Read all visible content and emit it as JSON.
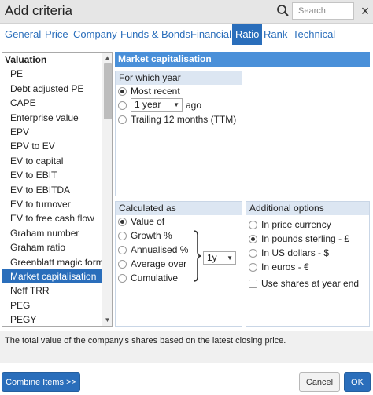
{
  "window": {
    "title": "Add criteria"
  },
  "search": {
    "placeholder": "Search",
    "icon": "search-icon"
  },
  "close": {
    "symbol": "×"
  },
  "tabs": [
    {
      "label": "General"
    },
    {
      "label": "Price"
    },
    {
      "label": "Company"
    },
    {
      "label": "Funds & Bonds"
    },
    {
      "label": "Financial"
    },
    {
      "label": "Ratio",
      "active": true
    },
    {
      "label": "Rank"
    },
    {
      "label": "Technical"
    }
  ],
  "criteria_list": {
    "items": [
      {
        "label": "Valuation",
        "header": true
      },
      {
        "label": "PE"
      },
      {
        "label": "Debt adjusted PE"
      },
      {
        "label": "CAPE"
      },
      {
        "label": "Enterprise value"
      },
      {
        "label": "EPV"
      },
      {
        "label": "EPV to EV"
      },
      {
        "label": "EV to capital"
      },
      {
        "label": "EV to EBIT"
      },
      {
        "label": "EV to EBITDA"
      },
      {
        "label": "EV to turnover"
      },
      {
        "label": "EV to free cash flow"
      },
      {
        "label": "Graham number"
      },
      {
        "label": "Graham ratio"
      },
      {
        "label": "Greenblatt magic form."
      },
      {
        "label": "Market capitalisation",
        "selected": true
      },
      {
        "label": "Neff TRR"
      },
      {
        "label": "PEG"
      },
      {
        "label": "PEGY"
      }
    ]
  },
  "main": {
    "heading": "Market capitalisation",
    "which_year": {
      "title": "For which year",
      "most_recent": "Most recent",
      "year_select": "1 year",
      "ago": "ago",
      "ttm": "Trailing 12 months (TTM)"
    },
    "calculated_as": {
      "title": "Calculated as",
      "value_of": "Value of",
      "growth": "Growth %",
      "annualised": "Annualised %",
      "average_over": "Average over",
      "cumulative": "Cumulative",
      "period_select": "1y"
    },
    "additional": {
      "title": "Additional options",
      "price_currency": "In price currency",
      "pounds": "In pounds sterling - £",
      "dollars": "In US dollars - $",
      "euros": "In euros - €",
      "shares_year_end": "Use shares at year end"
    }
  },
  "description": "The total value of the company's shares based on the latest closing price.",
  "buttons": {
    "combine": "Combine Items >>",
    "cancel": "Cancel",
    "ok": "OK"
  },
  "colors": {
    "accent": "#2a6ebb",
    "heading_bar": "#4a90d9",
    "group_header": "#dce6f2"
  }
}
